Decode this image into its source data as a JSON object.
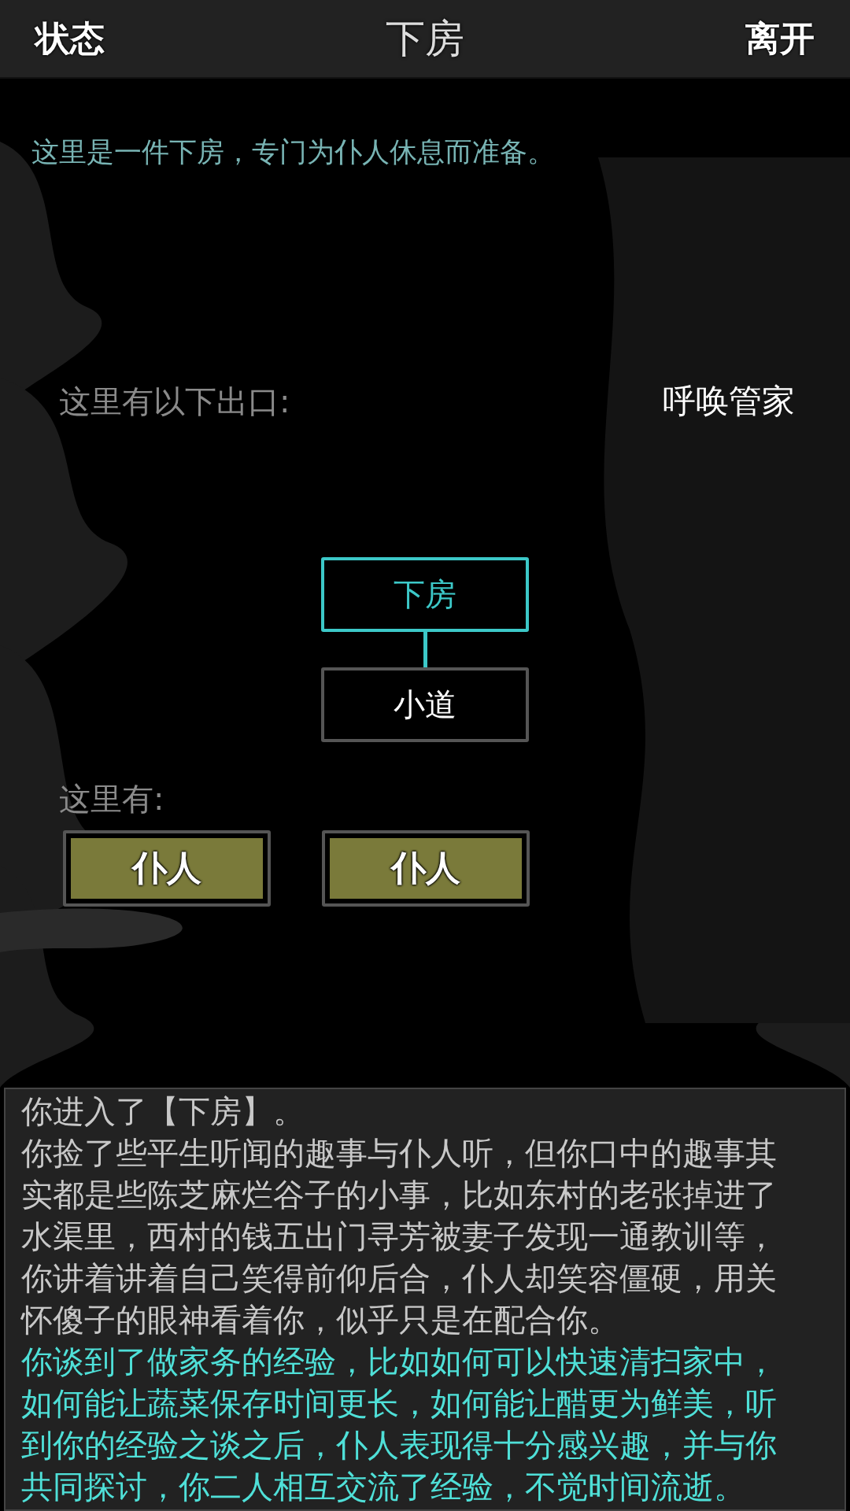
{
  "top_bar": {
    "left_button": "状态",
    "title": "下房",
    "right_button": "离开"
  },
  "description": "这里是一件下房，专门为仆人休息而准备。",
  "exits_label": "这里有以下出口:",
  "action": "呼唤管家",
  "map": {
    "rooms": [
      {
        "name": "下房",
        "current": true
      },
      {
        "name": "小道",
        "current": false
      }
    ]
  },
  "here_label": "这里有:",
  "npcs": [
    {
      "name": "仆人"
    },
    {
      "name": "仆人"
    }
  ],
  "log": [
    {
      "text": "你进入了【下房】。",
      "color": "#c8c8c8"
    },
    {
      "text": "你捡了些平生听闻的趣事与仆人听，但你口中的趣事其实都是些陈芝麻烂谷子的小事，比如东村的老张掉进了水渠里，西村的钱五出门寻芳被妻子发现一通教训等，你讲着讲着自己笑得前仰后合，仆人却笑容僵硬，用关怀傻子的眼神看着你，似乎只是在配合你。",
      "color": "#c8c8c8"
    },
    {
      "text": "你谈到了做家务的经验，比如如何可以快速清扫家中，如何能让蔬菜保存时间更长，如何能让醋更为鲜美，听到你的经验之谈之后，仆人表现得十分感兴趣，并与你共同探讨，你二人相互交流了经验，不觉时间流逝。",
      "color": "#4fe0d8"
    }
  ]
}
